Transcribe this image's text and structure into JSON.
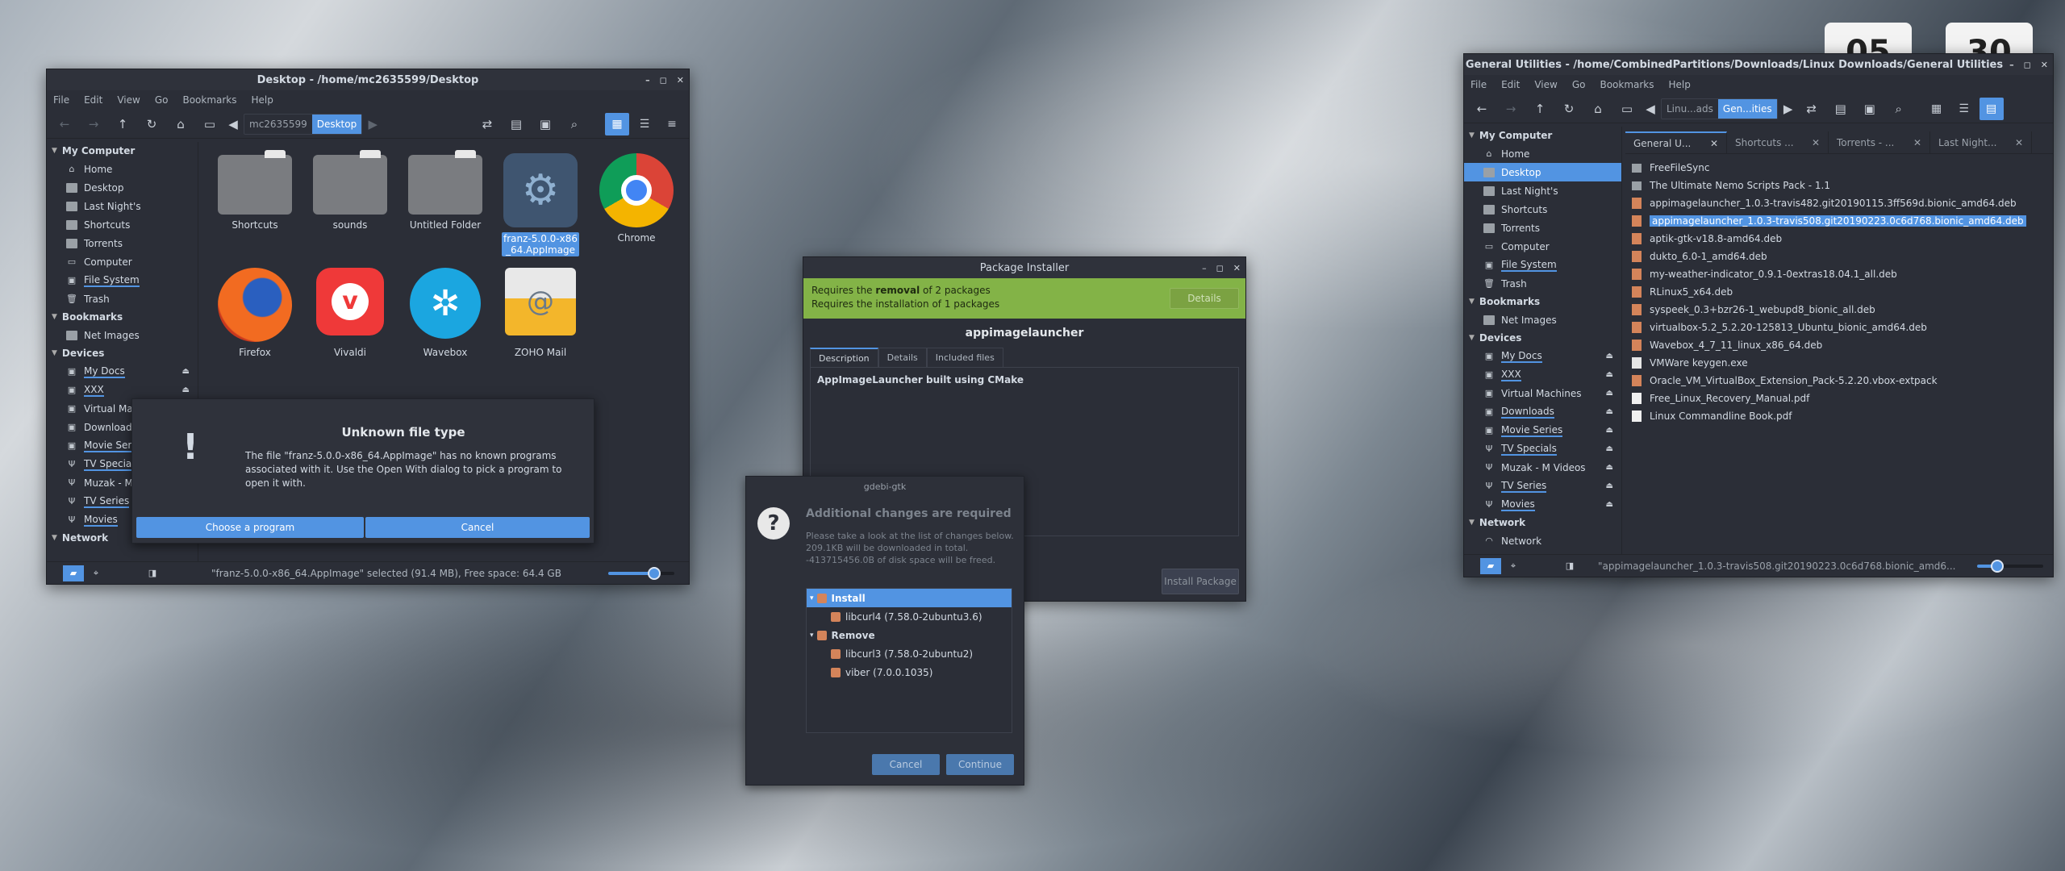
{
  "desktop": {
    "clock": [
      "05",
      "30"
    ]
  },
  "win1": {
    "title": "Desktop - /home/mc2635599/Desktop",
    "menu": [
      "File",
      "Edit",
      "View",
      "Go",
      "Bookmarks",
      "Help"
    ],
    "crumbs": [
      "mc2635599",
      "Desktop"
    ],
    "sidebar": {
      "my_computer": "My Computer",
      "places": [
        "Home",
        "Desktop",
        "Last Night's",
        "Shortcuts",
        "Torrents",
        "Computer",
        "File System",
        "Trash"
      ],
      "bookmarks": "Bookmarks",
      "bookmark_items": [
        "Net Images"
      ],
      "devices": "Devices",
      "device_items": [
        "My Docs",
        "XXX",
        "Virtual Ma",
        "Download",
        "Movie Seri",
        "TV Special",
        "Muzak - M",
        "TV Series",
        "Movies"
      ],
      "network": "Network"
    },
    "icons": [
      {
        "label": "Shortcuts"
      },
      {
        "label": "sounds"
      },
      {
        "label": "Untitled Folder"
      },
      {
        "label": "franz-5.0.0-x86_64.AppImage"
      },
      {
        "label": "Chrome"
      },
      {
        "label": "Firefox"
      },
      {
        "label": "Vivaldi"
      },
      {
        "label": "Wavebox"
      },
      {
        "label": "ZOHO Mail"
      }
    ],
    "status": "\"franz-5.0.0-x86_64.AppImage\" selected (91.4 MB), Free space: 64.4 GB",
    "zoom_fraction": 0.7
  },
  "unknown_dialog": {
    "title": "Unknown file type",
    "message": "The file \"franz-5.0.0-x86_64.AppImage\" has no known programs associated with it.  Use the Open With dialog to pick a program to open it with.",
    "choose": "Choose a program",
    "cancel": "Cancel"
  },
  "pkg": {
    "title": "Package Installer",
    "banner1_pre": "Requires the ",
    "banner1_bold": "removal",
    "banner1_post": " of 2 packages",
    "banner2": "Requires the installation of 1 packages",
    "details_btn": "Details",
    "name": "appimagelauncher",
    "tabs": [
      "Description",
      "Details",
      "Included files"
    ],
    "description": "AppImageLauncher built using CMake",
    "install_btn": "Install Package"
  },
  "gdebi": {
    "title": "gdebi-gtk",
    "heading": "Additional changes are required",
    "text1": "Please take a look at the list of changes below.",
    "text2": "209.1KB will be downloaded in total.",
    "text3": "-413715456.0B of disk space will be freed.",
    "install_group": "Install",
    "install_items": [
      "libcurl4 (7.58.0-2ubuntu3.6)"
    ],
    "remove_group": "Remove",
    "remove_items": [
      "libcurl3 (7.58.0-2ubuntu2)",
      "viber (7.0.0.1035)"
    ],
    "cancel": "Cancel",
    "continue": "Continue"
  },
  "win2": {
    "title": "General Utilities - /home/CombinedPartitions/Downloads/Linux Downloads/General Utilities",
    "menu": [
      "File",
      "Edit",
      "View",
      "Go",
      "Bookmarks",
      "Help"
    ],
    "crumbs": [
      "Linu...ads",
      "Gen...ities"
    ],
    "tabs": [
      "General U...",
      "Shortcuts ...",
      "Torrents - ...",
      "Last Night..."
    ],
    "sidebar": {
      "my_computer": "My Computer",
      "places": [
        "Home",
        "Desktop",
        "Last Night's",
        "Shortcuts",
        "Torrents",
        "Computer",
        "File System",
        "Trash"
      ],
      "bookmarks": "Bookmarks",
      "bookmark_items": [
        "Net Images"
      ],
      "devices": "Devices",
      "device_items": [
        "My Docs",
        "XXX",
        "Virtual Machines",
        "Downloads",
        "Movie Series",
        "TV Specials",
        "Muzak - M Videos",
        "TV Series",
        "Movies"
      ],
      "network": "Network",
      "network_items": [
        "Network"
      ]
    },
    "files": [
      "FreeFileSync",
      "The Ultimate Nemo Scripts Pack - 1.1",
      "appimagelauncher_1.0.3-travis482.git20190115.3ff569d.bionic_amd64.deb",
      "appimagelauncher_1.0.3-travis508.git20190223.0c6d768.bionic_amd64.deb",
      "aptik-gtk-v18.8-amd64.deb",
      "dukto_6.0-1_amd64.deb",
      "my-weather-indicator_0.9.1-0extras18.04.1_all.deb",
      "RLinux5_x64.deb",
      "syspeek_0.3+bzr26-1_webupd8_bionic_all.deb",
      "virtualbox-5.2_5.2.20-125813_Ubuntu_bionic_amd64.deb",
      "Wavebox_4_7_11_linux_x86_64.deb",
      "VMWare keygen.exe",
      "Oracle_VM_VirtualBox_Extension_Pack-5.2.20.vbox-extpack",
      "Free_Linux_Recovery_Manual.pdf",
      "Linux Commandline Book.pdf"
    ],
    "status": "\"appimagelauncher_1.0.3-travis508.git20190223.0c6d768.bionic_amd6...",
    "zoom_fraction": 0.3
  }
}
